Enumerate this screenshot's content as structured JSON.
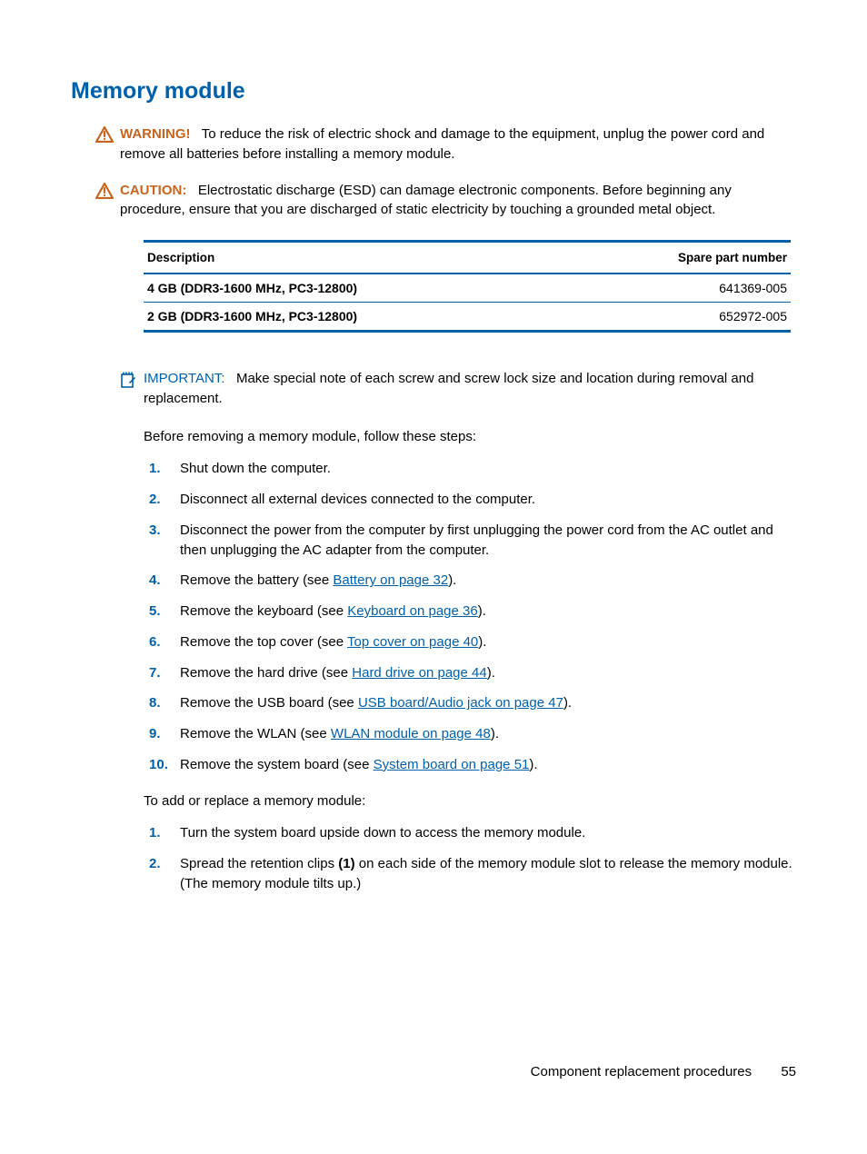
{
  "heading": "Memory module",
  "warning": {
    "label": "WARNING!",
    "text": "To reduce the risk of electric shock and damage to the equipment, unplug the power cord and remove all batteries before installing a memory module."
  },
  "caution": {
    "label": "CAUTION:",
    "text": "Electrostatic discharge (ESD) can damage electronic components. Before beginning any procedure, ensure that you are discharged of static electricity by touching a grounded metal object."
  },
  "table": {
    "headers": {
      "desc": "Description",
      "num": "Spare part number"
    },
    "rows": [
      {
        "desc": "4 GB (DDR3-1600 MHz, PC3-12800)",
        "num": "641369-005"
      },
      {
        "desc": "2 GB (DDR3-1600 MHz, PC3-12800)",
        "num": "652972-005"
      }
    ]
  },
  "important": {
    "label": "IMPORTANT:",
    "text": "Make special note of each screw and screw lock size and location during removal and replacement."
  },
  "intro1": "Before removing a memory module, follow these steps:",
  "steps1": [
    {
      "pre": "Shut down the computer."
    },
    {
      "pre": "Disconnect all external devices connected to the computer."
    },
    {
      "pre": "Disconnect the power from the computer by first unplugging the power cord from the AC outlet and then unplugging the AC adapter from the computer."
    },
    {
      "pre": "Remove the battery (see ",
      "link": "Battery on page 32",
      "post": ")."
    },
    {
      "pre": "Remove the keyboard (see ",
      "link": "Keyboard on page 36",
      "post": ")."
    },
    {
      "pre": "Remove the top cover (see ",
      "link": "Top cover on page 40",
      "post": ")."
    },
    {
      "pre": "Remove the hard drive (see ",
      "link": "Hard drive on page 44",
      "post": ")."
    },
    {
      "pre": "Remove the USB board (see ",
      "link": "USB board/Audio jack on page 47",
      "post": ")."
    },
    {
      "pre": "Remove the WLAN (see ",
      "link": "WLAN module on page 48",
      "post": ")."
    },
    {
      "pre": "Remove the system board (see ",
      "link": "System board on page 51",
      "post": ")."
    }
  ],
  "intro2": "To add or replace a memory module:",
  "steps2": [
    {
      "pre": "Turn the system board upside down to access the memory module."
    },
    {
      "pre": "Spread the retention clips ",
      "bold": "(1)",
      "post": " on each side of the memory module slot to release the memory module. (The memory module tilts up.)"
    }
  ],
  "footer": {
    "section": "Component replacement procedures",
    "page": "55"
  }
}
